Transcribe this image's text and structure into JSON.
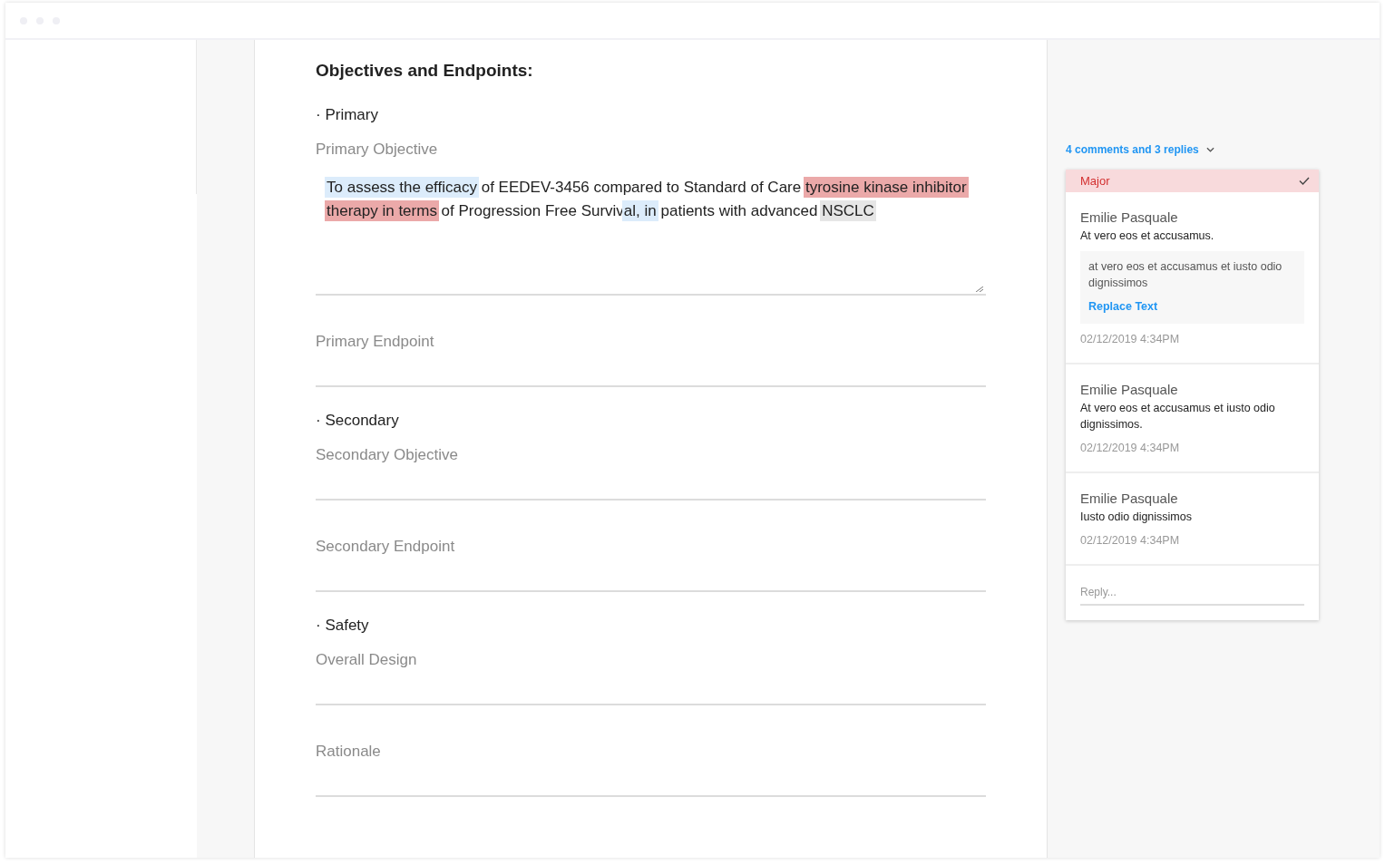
{
  "document": {
    "heading": "Objectives and Endpoints:",
    "sections": [
      {
        "title": "· Primary",
        "fields": [
          {
            "label": "Primary Objective",
            "segments": [
              {
                "text": "To assess the efficacy",
                "kind": "comment"
              },
              {
                "text": " of EEDEV-3456 compared to Standard of Care ",
                "kind": "plain"
              },
              {
                "text": "tyrosine kinase inhibitor therapy in terms",
                "kind": "major"
              },
              {
                "text": " of Progression Free Surviv",
                "kind": "plain"
              },
              {
                "text": "al, in",
                "kind": "comment"
              },
              {
                "text": " patients with advanced ",
                "kind": "plain"
              },
              {
                "text": "NSCLC",
                "kind": "suggestion"
              }
            ]
          },
          {
            "label": "Primary Endpoint"
          }
        ]
      },
      {
        "title": "· Secondary",
        "fields": [
          {
            "label": "Secondary Objective"
          },
          {
            "label": "Secondary Endpoint"
          }
        ]
      },
      {
        "title": "· Safety",
        "fields": [
          {
            "label": "Overall Design"
          },
          {
            "label": "Rationale"
          }
        ]
      }
    ]
  },
  "comments_panel": {
    "summary": "4 comments and 3 replies",
    "expanded": true,
    "thread": {
      "severity": "Major",
      "resolved": true,
      "comments": [
        {
          "author": "Emilie Pasquale",
          "body": "At vero eos et accusamus.",
          "suggestion": {
            "text": "at vero eos et accusamus et iusto odio dignissimos",
            "action": "Replace Text"
          },
          "time": "02/12/2019 4:34PM"
        },
        {
          "author": "Emilie Pasquale",
          "body": "At vero eos et accusamus et iusto odio dignissimos.",
          "time": "02/12/2019 4:34PM"
        },
        {
          "author": "Emilie Pasquale",
          "body": "Iusto odio dignissimos",
          "time": "02/12/2019 4:34PM"
        }
      ],
      "reply": {
        "placeholder": "Reply..."
      }
    }
  }
}
